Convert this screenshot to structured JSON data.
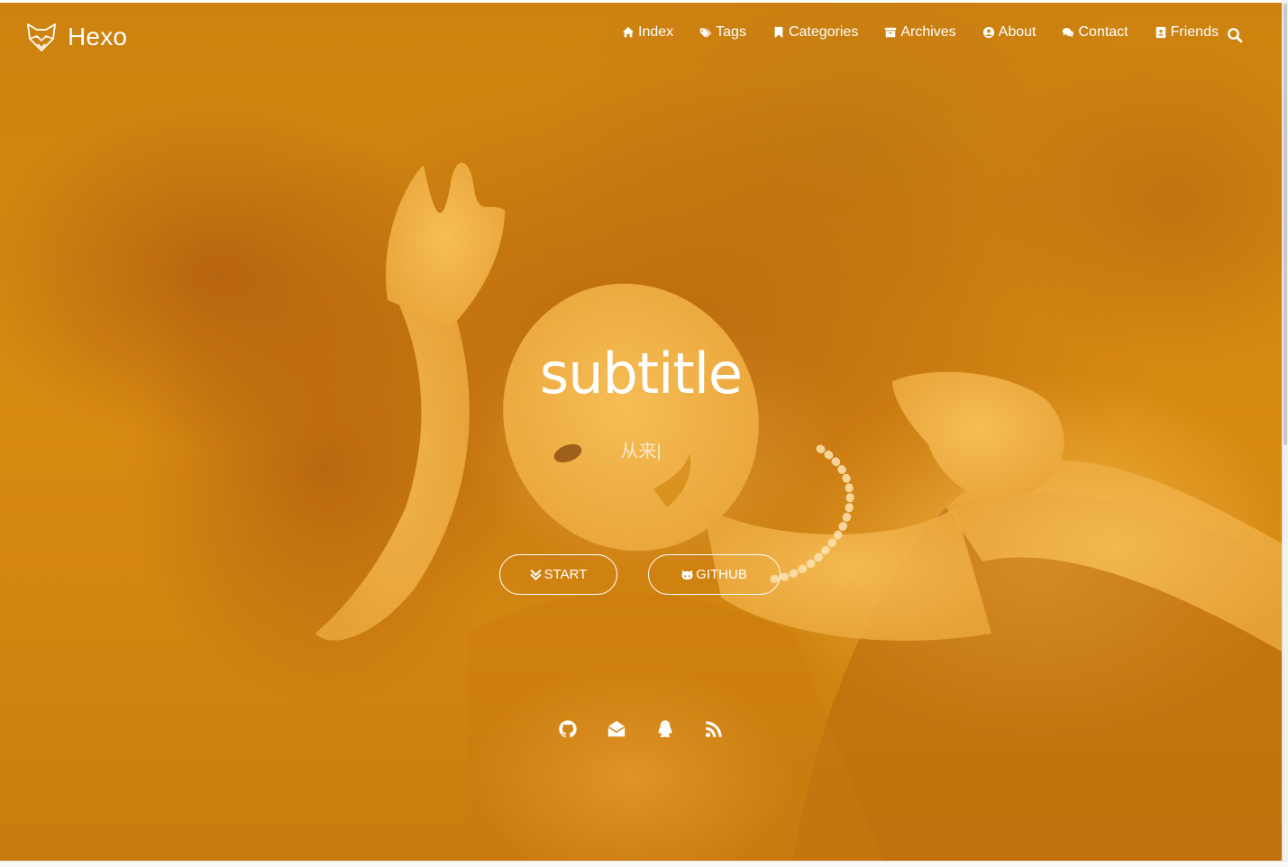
{
  "brand": {
    "name": "Hexo"
  },
  "nav": {
    "items": [
      {
        "label": "Index",
        "icon": "home-icon"
      },
      {
        "label": "Tags",
        "icon": "tags-icon"
      },
      {
        "label": "Categories",
        "icon": "bookmark-icon"
      },
      {
        "label": "Archives",
        "icon": "archive-icon"
      },
      {
        "label": "About",
        "icon": "user-circle-icon"
      },
      {
        "label": "Contact",
        "icon": "comments-icon"
      },
      {
        "label": "Friends",
        "icon": "address-book-icon"
      }
    ],
    "search_icon": "search-icon"
  },
  "hero": {
    "title": "subtitle",
    "typed_text": "从来",
    "typed_cursor": "|",
    "overlay_color": "#d88b12"
  },
  "buttons": {
    "start_label": "START",
    "github_label": "GITHUB"
  },
  "social": [
    "github-icon",
    "mail-icon",
    "qq-icon",
    "rss-icon"
  ]
}
